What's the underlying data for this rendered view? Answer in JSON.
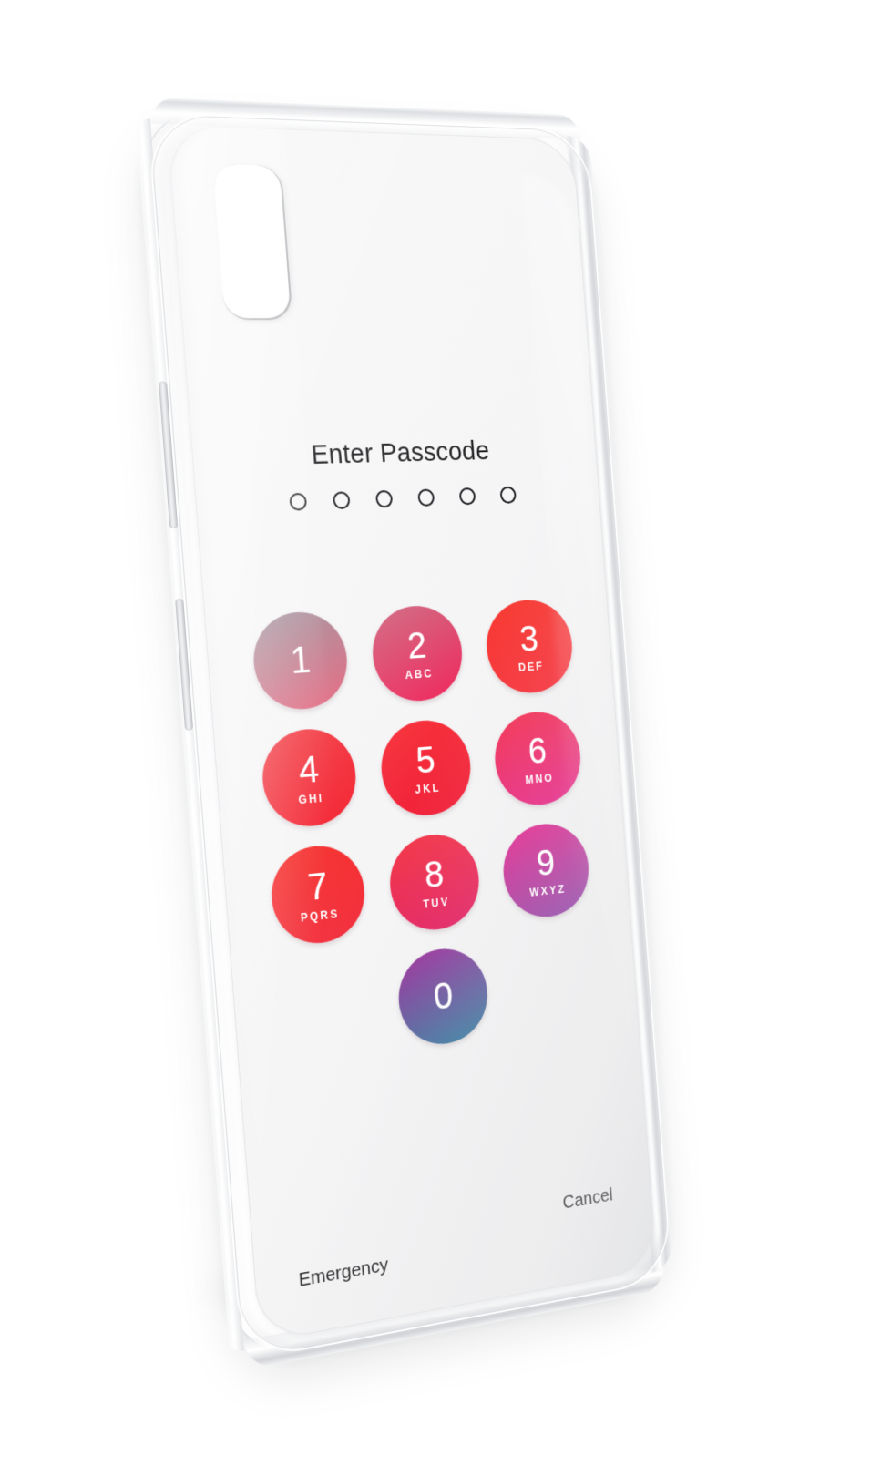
{
  "product": {
    "type": "transparent-phone-case-mockup",
    "background_color": "#ffffff",
    "case_body_color": "#f5f5f6",
    "case_edge_color": "#e6e7e9"
  },
  "lockscreen": {
    "title": "Enter Passcode",
    "passcode_dot_count": 6,
    "passcode_dots_filled": 0,
    "dot_border_color": "#16161a",
    "title_color": "#1a1a1c",
    "keypad": [
      {
        "digit": "1",
        "letters": "",
        "gradient_from": "#9b8e99",
        "gradient_to": "#e8657e"
      },
      {
        "digit": "2",
        "letters": "ABC",
        "gradient_from": "#d0667f",
        "gradient_to": "#f0295e"
      },
      {
        "digit": "3",
        "letters": "DEF",
        "gradient_from": "#f8382f",
        "gradient_to": "#f6303c"
      },
      {
        "digit": "4",
        "letters": "GHI",
        "gradient_from": "#f23a42",
        "gradient_to": "#f4202f"
      },
      {
        "digit": "5",
        "letters": "JKL",
        "gradient_from": "#f7323a",
        "gradient_to": "#f01f3a"
      },
      {
        "digit": "6",
        "letters": "MNO",
        "gradient_from": "#f4324f",
        "gradient_to": "#e5258c"
      },
      {
        "digit": "7",
        "letters": "PQRS",
        "gradient_from": "#f62c28",
        "gradient_to": "#f23040"
      },
      {
        "digit": "8",
        "letters": "TUV",
        "gradient_from": "#f43a48",
        "gradient_to": "#e11f66"
      },
      {
        "digit": "9",
        "letters": "WXYZ",
        "gradient_from": "#e8298e",
        "gradient_to": "#8a43a8"
      },
      {
        "digit": "0",
        "letters": "",
        "gradient_from": "#a12f9c",
        "gradient_to": "#2e7f9e"
      }
    ],
    "footer": {
      "emergency_label": "Emergency",
      "cancel_label": "Cancel"
    }
  },
  "hardware": {
    "camera_cutout": "camera-cutout",
    "side_buttons": [
      "volume-up",
      "volume-down"
    ]
  }
}
